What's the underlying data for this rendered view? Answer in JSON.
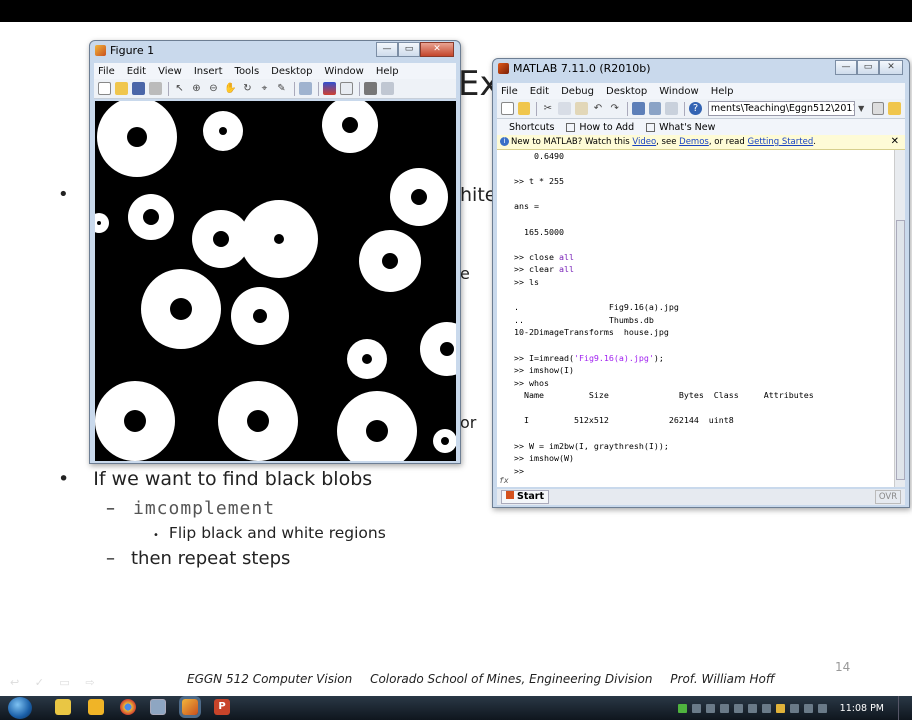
{
  "slide": {
    "title_fragment": "Ex",
    "bullet_fragment_1": "hite",
    "bullet_fragment_2": "e",
    "bullet_fragment_3": "or",
    "bullet_symbol": "•",
    "main_bullet": "If we want to find black blobs",
    "dash": "–",
    "sub_bullet_1": "imcomplement",
    "sub_sub_bullet": "Flip black and white regions",
    "sub_bullet_2": "then repeat steps",
    "footer": {
      "course": "EGGN 512  Computer Vision",
      "school": "Colorado School of Mines, Engineering Division",
      "prof": "Prof. William Hoff"
    },
    "page_number": "14",
    "ghost_controls": "↩ ✓ ▭ ⇨"
  },
  "figure_window": {
    "title": "Figure 1",
    "menu": [
      "File",
      "Edit",
      "View",
      "Insert",
      "Tools",
      "Desktop",
      "Window",
      "Help"
    ],
    "toolbar_icons": [
      "new-icon",
      "open-icon",
      "save-icon",
      "print-icon",
      "pointer-icon",
      "zoom-in-icon",
      "zoom-out-icon",
      "pan-icon",
      "rotate-icon",
      "data-cursor-icon",
      "brush-icon",
      "link-icon",
      "colorbar-icon",
      "legend-icon",
      "hide-plot-icon",
      "show-plot-icon"
    ],
    "image_colors": {
      "background": "#000000",
      "blob": "#ffffff"
    }
  },
  "matlab_window": {
    "title": "MATLAB  7.11.0 (R2010b)",
    "menu": [
      "File",
      "Edit",
      "Debug",
      "Desktop",
      "Window",
      "Help"
    ],
    "current_folder": "ments\\Teaching\\Eggn512\\2011\\demos",
    "shortcuts": [
      "Shortcuts",
      "How to Add",
      "What's New"
    ],
    "notice": {
      "prefix": "New to MATLAB? Watch this ",
      "link1": "Video",
      "mid1": ", see ",
      "link2": "Demos",
      "mid2": ", or read ",
      "link3": "Getting Started",
      "suffix": "."
    },
    "command_lines": [
      "    0.6490",
      "",
      ">> t * 255",
      "",
      "ans =",
      "",
      "  165.5000",
      "",
      ">> close all",
      ">> clear all",
      ">> ls",
      "",
      ".                  Fig9.16(a).jpg",
      "..                 Thumbs.db",
      "10-2DimageTransforms  house.jpg",
      "",
      ">> I=imread('Fig9.16(a).jpg');",
      ">> imshow(I)",
      ">> whos",
      "  Name         Size              Bytes  Class     Attributes",
      "",
      "  I         512x512            262144  uint8",
      "",
      ">> W = im2bw(I, graythresh(I));",
      ">> imshow(W)",
      ">> "
    ],
    "prompt_fx": "fx",
    "start_label": "Start",
    "ovr_label": "OVR"
  },
  "taskbar": {
    "clock": "11:08 PM",
    "apps": [
      "explorer-icon",
      "folder-icon",
      "chrome-icon",
      "desktop-icon",
      "matlab-icon",
      "powerpoint-icon"
    ]
  }
}
